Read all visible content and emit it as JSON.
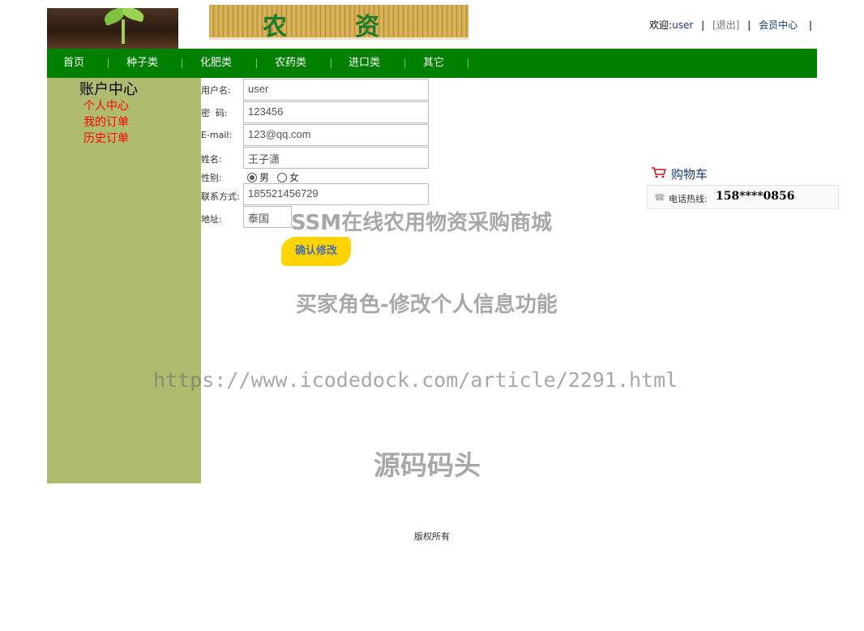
{
  "header": {
    "banner_text": [
      "农",
      "资"
    ],
    "welcome_prefix": "欢迎:",
    "username": "user",
    "logout_label": "[退出]",
    "member_center_label": "会员中心",
    "separator": "|"
  },
  "nav": {
    "items": [
      "首页",
      "种子类",
      "化肥类",
      "农药类",
      "进口类",
      "其它"
    ],
    "background": "#008000"
  },
  "sidebar": {
    "title": "账户中心",
    "links": [
      "个人中心",
      "我的订单",
      "历史订单"
    ],
    "background": "#afbb6f",
    "link_color": "#ff0000"
  },
  "form": {
    "username_label": "用户名:",
    "username_value": "user",
    "password_label": "密  码:",
    "password_value": "123456",
    "email_label": "E-mail:",
    "email_value": "123@qq.com",
    "name_label": "姓名:",
    "name_value": "王子潇",
    "gender_label": "性别:",
    "gender_male": "男",
    "gender_female": "女",
    "gender_selected": "男",
    "contact_label": "联系方式:",
    "contact_value": "185521456729",
    "address_label": "地址:",
    "address_value": "泰国",
    "submit_label": "确认修改"
  },
  "cart": {
    "label": "购物车",
    "icon": "shopping-cart-icon"
  },
  "hotline": {
    "icon": "phone-icon",
    "label": "电话热线:",
    "number": "158****0856"
  },
  "watermarks": {
    "title": "SSM在线农用物资采购商城",
    "subtitle": "买家角色-修改个人信息功能",
    "url": "https://www.icodedock.com/article/2291.html",
    "brand": "源码码头"
  },
  "footer": {
    "text": "版权所有"
  }
}
